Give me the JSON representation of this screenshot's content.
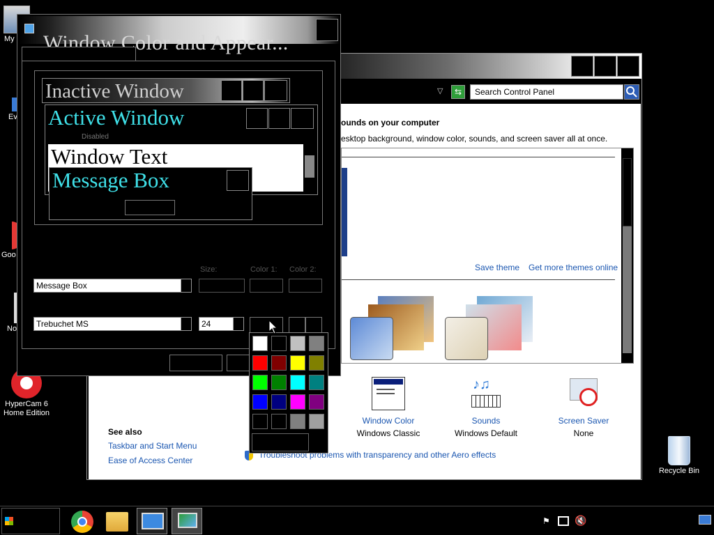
{
  "desktop": {
    "icons": [
      {
        "label": "My"
      },
      {
        "label": "Ev"
      },
      {
        "label": "Goo"
      },
      {
        "label": "No"
      },
      {
        "label": "HyperCam 6 Home Edition"
      },
      {
        "label": "Recycle Bin"
      }
    ]
  },
  "control_panel": {
    "search_placeholder": "Search Control Panel",
    "heading": "ounds on your computer",
    "subheading": "esktop background, window color, sounds, and screen saver all at once.",
    "save_theme": "Save theme",
    "more_themes": "Get more themes online",
    "bottom_items": [
      {
        "title": "Window Color",
        "value": "Windows Classic"
      },
      {
        "title": "Sounds",
        "value": "Windows Default"
      },
      {
        "title": "Screen Saver",
        "value": "None"
      }
    ],
    "see_also": {
      "heading": "See also",
      "links": [
        "Taskbar and Start Menu",
        "Ease of Access Center"
      ]
    },
    "troubleshoot": "Troubleshoot problems with transparency and other Aero effects"
  },
  "appearance": {
    "title": "Window Color and Appear...",
    "preview": {
      "inactive": "Inactive Window",
      "active": "Active Window",
      "disabled": "Disabled",
      "window_text": "Window Text",
      "message_box": "Message Box"
    },
    "labels": {
      "size": "Size:",
      "color1": "Color 1:",
      "color2": "Color 2:"
    },
    "item_value": "Message Box",
    "font_value": "Trebuchet MS",
    "font_size": "24",
    "palette": [
      "#ffffff",
      "#000000",
      "#c0c0c0",
      "#808080",
      "#ff0000",
      "#800000",
      "#ffff00",
      "#808000",
      "#00ff00",
      "#008000",
      "#00ffff",
      "#008080",
      "#0000ff",
      "#000080",
      "#ff00ff",
      "#800080",
      "#000000",
      "#000000",
      "#808080",
      "#a0a0a0"
    ]
  },
  "colors": {
    "accent_cyan": "#3fe0e8",
    "link": "#1a56b0"
  }
}
